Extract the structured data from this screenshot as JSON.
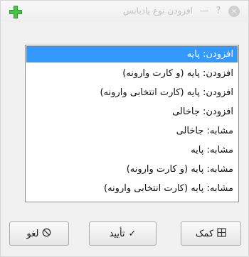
{
  "window": {
    "title": "افزودن نوع پادبانس",
    "app_icon": "green-plus-icon",
    "controls": {
      "minimize": "—",
      "help": "?",
      "close": "×"
    }
  },
  "list": {
    "items": [
      {
        "label": "افزودن: پایه",
        "selected": true
      },
      {
        "label": "افزودن: پایه (و کارت وارونه)",
        "selected": false
      },
      {
        "label": "افزودن: پایه (کارت انتخابی وارونه)",
        "selected": false
      },
      {
        "label": "افزودن: جاخالی",
        "selected": false
      },
      {
        "label": "مشابه: جاخالی",
        "selected": false
      },
      {
        "label": "مشابه: پایه",
        "selected": false
      },
      {
        "label": "مشابه: پایه (و کارت وارونه)",
        "selected": false
      },
      {
        "label": "مشابه: پایه (کارت انتخابی وارونه)",
        "selected": false
      }
    ],
    "selected_color": "#3399ff"
  },
  "buttons": {
    "help_label": "کمک",
    "help_icon": "help-book-icon",
    "ok_label": "تأیید",
    "ok_icon": "checkmark-icon",
    "cancel_label": "لغو",
    "cancel_icon": "cancel-circle-icon"
  }
}
